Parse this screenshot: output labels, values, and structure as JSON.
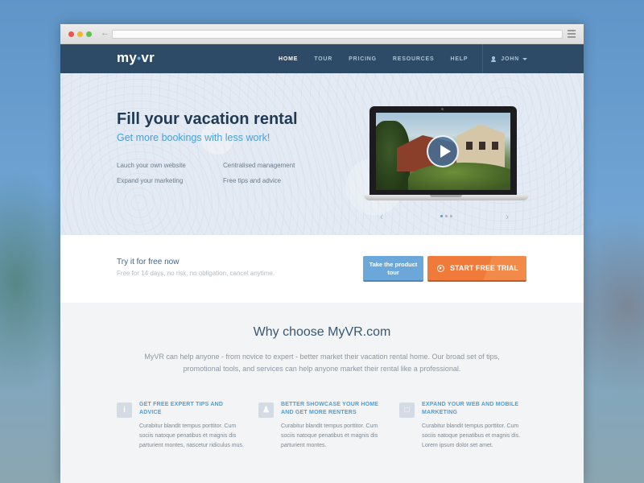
{
  "browser": {
    "back_icon": "back-arrow-icon"
  },
  "nav": {
    "logo_left": "my",
    "logo_sep": "•",
    "logo_right": "vr",
    "links": [
      "HOME",
      "TOUR",
      "PRICING",
      "RESOURCES",
      "HELP"
    ],
    "active": "HOME",
    "user": "JOHN"
  },
  "hero": {
    "title": "Fill your vacation rental",
    "subtitle": "Get more bookings with less work!",
    "features": [
      "Lauch your own website",
      "Centralised management",
      "Expand your marketing",
      "Free tips and advice"
    ],
    "slider": {
      "prev": "‹",
      "next": "›",
      "dot_count": 3,
      "active_dot": 0
    }
  },
  "trial": {
    "title": "Try it for free now",
    "subtitle": "Free for 14 days, no risk, no obligation, cancel anytime.",
    "tour_button": "Take the product tour",
    "cta_button": "START FREE TRIAL"
  },
  "why": {
    "title": "Why choose MyVR.com",
    "text": "MyVR can help anyone - from novice to expert - better market their vacation rental home. Our broad set of tips, promotional tools, and services can help anyone market their rental like a professional.",
    "columns": [
      {
        "icon": "info-icon",
        "title": "GET FREE EXPERT TIPS AND ADVICE",
        "body": "Curabitur blandit tempus porttitor. Cum sociis natoque penatibus et magnis dis parturient montes, nascetur ridiculus mus."
      },
      {
        "icon": "person-icon",
        "title": "BETTER SHOWCASE YOUR HOME AND GET MORE RENTERS",
        "body": "Curabitur blandit tempus porttitor. Cum sociis natoque penatibus et magnis dis parturient montes."
      },
      {
        "icon": "monitor-icon",
        "title": "EXPAND YOUR WEB AND MOBILE MARKETING",
        "body": "Curabitur blandit tempus porttitor. Cum sociis natoque penatibus et magnis dis. Lorem ipsum dolor set amet."
      }
    ]
  },
  "colors": {
    "navbar": "#2d4b66",
    "accent_blue": "#4a9fd8",
    "cta_orange": "#ef7a3a"
  }
}
